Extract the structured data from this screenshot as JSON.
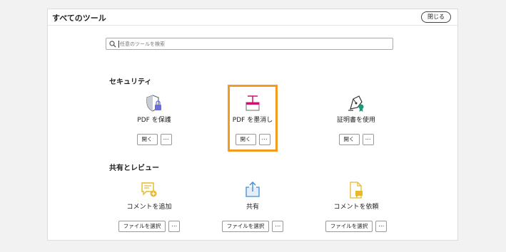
{
  "panel": {
    "title": "すべてのツール",
    "close_label": "閉じる"
  },
  "search": {
    "placeholder": "任意のツールを検索",
    "icon": "search-icon"
  },
  "sections": [
    {
      "title": "セキュリティ",
      "tools": [
        {
          "name": "PDF を保護",
          "icon": "shield-lock-icon",
          "open_label": "開く",
          "more_label": "⋯",
          "accent": "#6a6ed8"
        },
        {
          "name": "PDF を墨消し",
          "icon": "redact-icon",
          "open_label": "開く",
          "more_label": "⋯",
          "accent": "#d1116d",
          "highlighted": true
        },
        {
          "name": "証明書を使用",
          "icon": "certificate-pen-icon",
          "open_label": "開く",
          "more_label": "⋯",
          "accent": "#1a9a7a"
        }
      ]
    },
    {
      "title": "共有とレビュー",
      "tools": [
        {
          "name": "コメントを追加",
          "icon": "comment-add-icon",
          "open_label": "ファイルを選択",
          "more_label": "⋯",
          "accent": "#e8b82a"
        },
        {
          "name": "共有",
          "icon": "share-icon",
          "open_label": "ファイルを選択",
          "more_label": "⋯",
          "accent": "#3a8fd8"
        },
        {
          "name": "コメントを依頼",
          "icon": "request-comment-icon",
          "open_label": "ファイルを選択",
          "more_label": "⋯",
          "accent": "#e8b82a"
        }
      ]
    }
  ],
  "highlight_color": "#f39a1f"
}
